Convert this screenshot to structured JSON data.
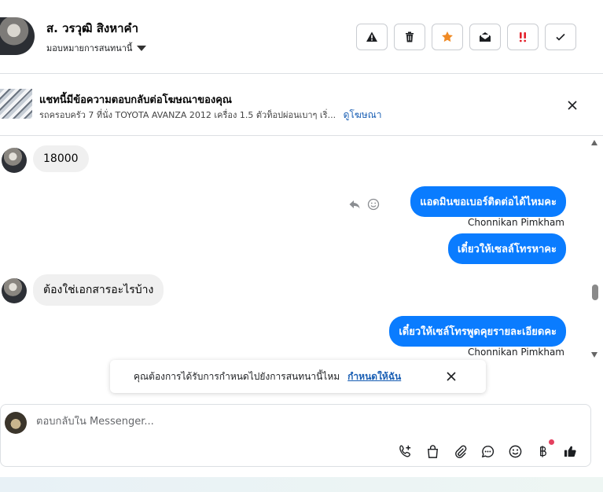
{
  "header": {
    "contact_name": "ส. วรวุฒิ สิงหาคำ",
    "assign_label": "มอบหมายการสนทนานี้",
    "actions": [
      {
        "icon": "warning-icon",
        "label": "Report spam"
      },
      {
        "icon": "trash-icon",
        "label": "Delete"
      },
      {
        "icon": "star-icon",
        "label": "Star",
        "color": "#f08a24"
      },
      {
        "icon": "mail-open-icon",
        "label": "Mark as unread"
      },
      {
        "icon": "priority-icon",
        "label": "Follow up",
        "color": "#e4202a"
      },
      {
        "icon": "check-icon",
        "label": "Mark as done"
      }
    ]
  },
  "ad": {
    "title": "แชทนี้มีข้อความตอบกลับต่อโฆษณาของคุณ",
    "subtitle": "รถครอบครัว 7 ที่นั่ง TOYOTA AVANZA 2012 เครื่อง 1.5 ตัวท็อปผ่อนเบาๆ เริ่...",
    "link": "ดูโฆษณา"
  },
  "messages": {
    "m1": "18000",
    "m2": "แอดมินขอเบอร์ติดต่อได้ไหมคะ",
    "m2_sender": "Chonnikan Pimkham",
    "m3": "เดี๋ยวให้เซลล์โทรหาคะ",
    "m4": "ต้องใช่เอกสารอะไรบ้าง",
    "m5": "เดี๋ยวให้เซล์โทรพูดคุยรายละเอียดคะ",
    "m5_sender": "Chonnikan Pimkham"
  },
  "toast": {
    "text": "คุณต้องการได้รับการกำหนดไปยังการสนทนานี้ไหม",
    "link": "กำหนดให้ฉัน"
  },
  "composer": {
    "placeholder": "ตอบกลับใน Messenger...",
    "tools": [
      "phone-plus-icon",
      "shopping-bag-icon",
      "paperclip-icon",
      "chat-bubble-icon",
      "emoji-icon",
      "baht-icon",
      "thumbs-up-icon"
    ]
  },
  "colors": {
    "outgoing_bubble": "#0a7cff",
    "incoming_bubble": "#f0f0f0",
    "link": "#1a5fb4"
  }
}
